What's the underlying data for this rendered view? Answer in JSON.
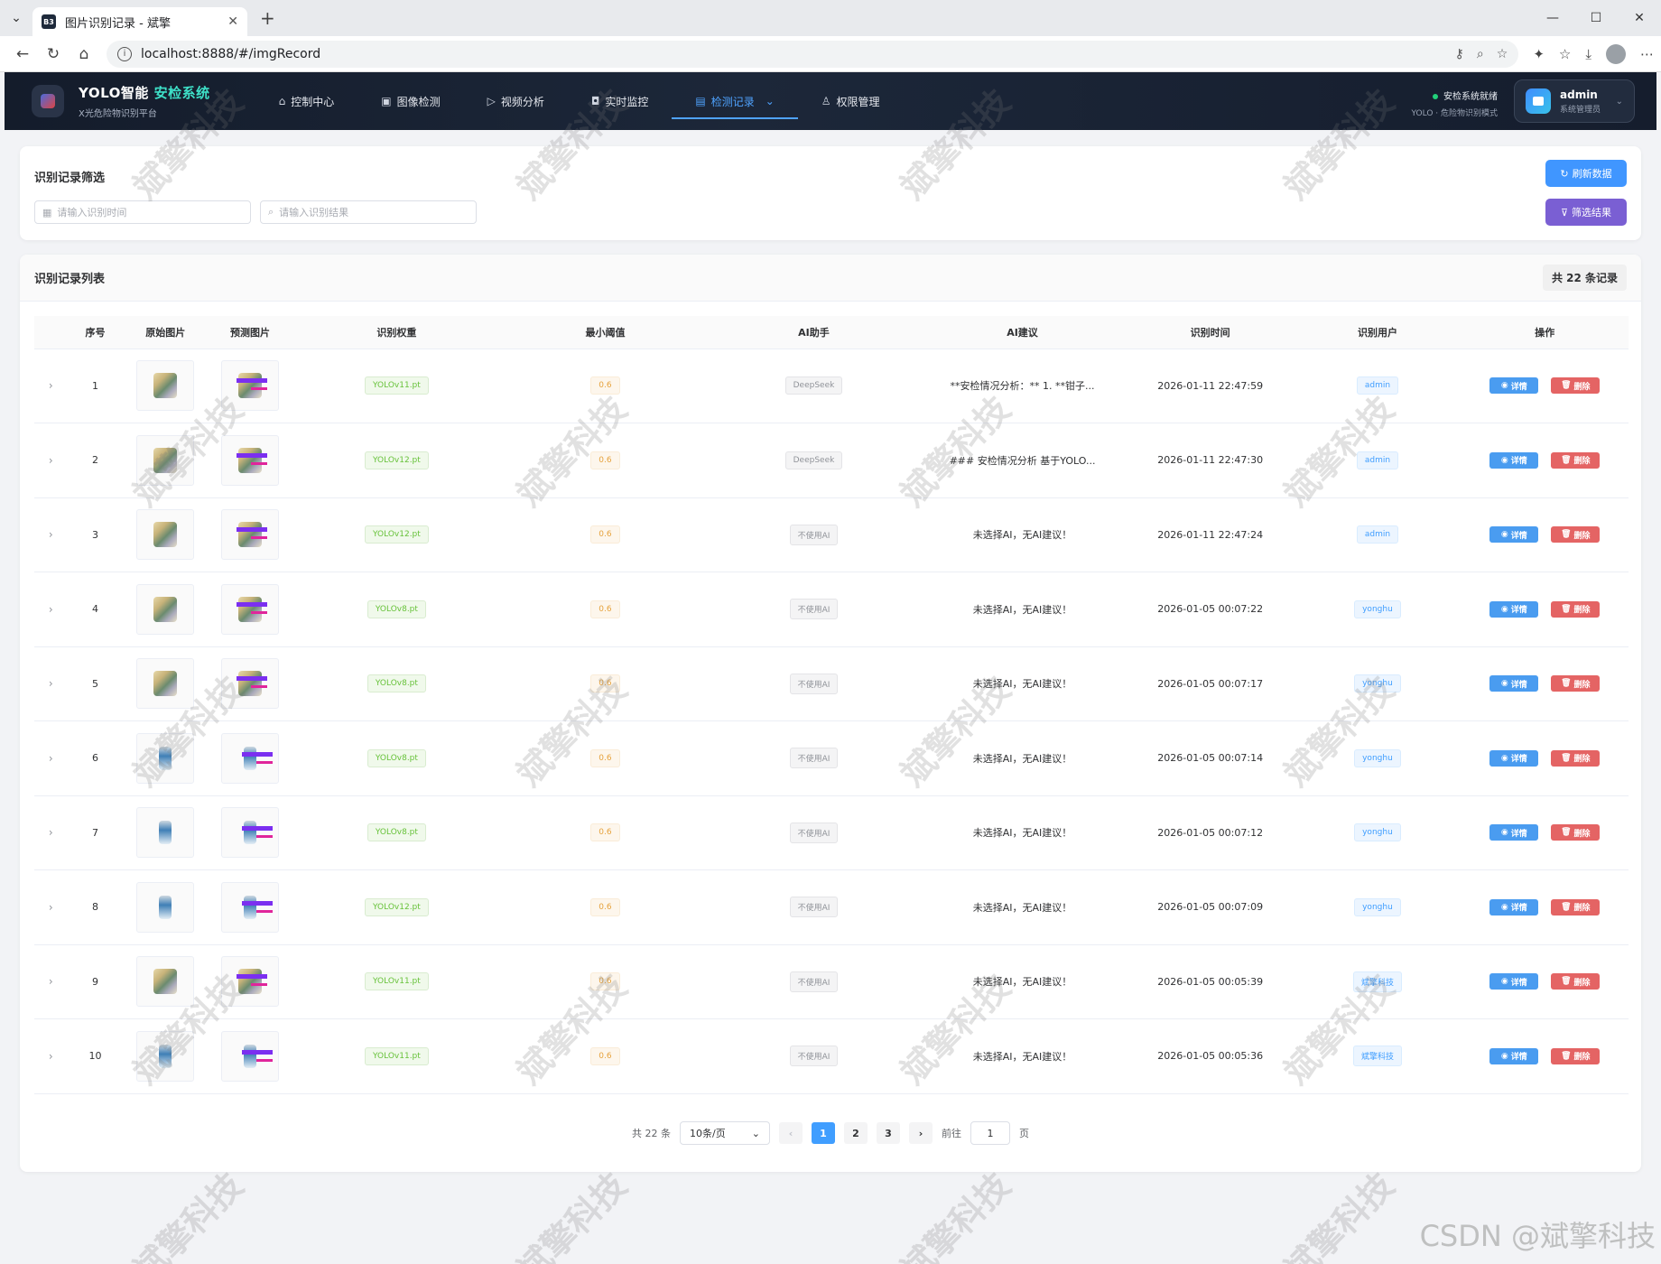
{
  "browser": {
    "tab_title": "图片识别记录 - 斌擎",
    "favicon": "B3",
    "url": "localhost:8888/#/imgRecord"
  },
  "header": {
    "brand_prefix": "YOLO智能 ",
    "brand_highlight": "安检系统",
    "subtitle": "X光危险物识别平台",
    "nav": [
      {
        "label": "控制中心",
        "icon": "home-icon"
      },
      {
        "label": "图像检测",
        "icon": "image-icon"
      },
      {
        "label": "视频分析",
        "icon": "play-icon"
      },
      {
        "label": "实时监控",
        "icon": "camera-icon"
      },
      {
        "label": "检测记录",
        "icon": "document-icon",
        "active": true
      },
      {
        "label": "权限管理",
        "icon": "user-icon"
      }
    ],
    "status_line1": "安检系统就绪",
    "status_line2": "YOLO · 危险物识别模式",
    "user_name": "admin",
    "user_role": "系统管理员"
  },
  "filter": {
    "title": "识别记录筛选",
    "time_placeholder": "请输入识别时间",
    "result_placeholder": "请输入识别结果",
    "refresh_label": "刷新数据",
    "filter_label": "筛选结果"
  },
  "list": {
    "title": "识别记录列表",
    "total": "共 22 条记录",
    "columns": [
      "序号",
      "原始图片",
      "预测图片",
      "识别权重",
      "最小阈值",
      "AI助手",
      "AI建议",
      "识别时间",
      "识别用户",
      "操作"
    ],
    "detail_label": "详情",
    "delete_label": "删除",
    "rows": [
      {
        "idx": "1",
        "weight": "YOLOv11.pt",
        "thr": "0.6",
        "ai": "DeepSeek",
        "sugg": "**安检情况分析：** 1. **钳子...",
        "time": "2026-01-11 22:47:59",
        "user": "admin"
      },
      {
        "idx": "2",
        "weight": "YOLOv12.pt",
        "thr": "0.6",
        "ai": "DeepSeek",
        "sugg": "### 安检情况分析 基于YOLO...",
        "time": "2026-01-11 22:47:30",
        "user": "admin"
      },
      {
        "idx": "3",
        "weight": "YOLOv12.pt",
        "thr": "0.6",
        "ai": "不使用AI",
        "sugg": "未选择AI，无AI建议！",
        "time": "2026-01-11 22:47:24",
        "user": "admin"
      },
      {
        "idx": "4",
        "weight": "YOLOv8.pt",
        "thr": "0.6",
        "ai": "不使用AI",
        "sugg": "未选择AI，无AI建议！",
        "time": "2026-01-05 00:07:22",
        "user": "yonghu"
      },
      {
        "idx": "5",
        "weight": "YOLOv8.pt",
        "thr": "0.6",
        "ai": "不使用AI",
        "sugg": "未选择AI，无AI建议！",
        "time": "2026-01-05 00:07:17",
        "user": "yonghu"
      },
      {
        "idx": "6",
        "weight": "YOLOv8.pt",
        "thr": "0.6",
        "ai": "不使用AI",
        "sugg": "未选择AI，无AI建议！",
        "time": "2026-01-05 00:07:14",
        "user": "yonghu"
      },
      {
        "idx": "7",
        "weight": "YOLOv8.pt",
        "thr": "0.6",
        "ai": "不使用AI",
        "sugg": "未选择AI，无AI建议！",
        "time": "2026-01-05 00:07:12",
        "user": "yonghu"
      },
      {
        "idx": "8",
        "weight": "YOLOv12.pt",
        "thr": "0.6",
        "ai": "不使用AI",
        "sugg": "未选择AI，无AI建议！",
        "time": "2026-01-05 00:07:09",
        "user": "yonghu"
      },
      {
        "idx": "9",
        "weight": "YOLOv11.pt",
        "thr": "0.6",
        "ai": "不使用AI",
        "sugg": "未选择AI，无AI建议！",
        "time": "2026-01-05 00:05:39",
        "user": "斌擎科技"
      },
      {
        "idx": "10",
        "weight": "YOLOv11.pt",
        "thr": "0.6",
        "ai": "不使用AI",
        "sugg": "未选择AI，无AI建议！",
        "time": "2026-01-05 00:05:36",
        "user": "斌擎科技"
      }
    ]
  },
  "pagination": {
    "total_text": "共 22 条",
    "page_size": "10条/页",
    "pages": [
      "1",
      "2",
      "3"
    ],
    "current": "1",
    "goto_label": "前往",
    "goto_value": "1",
    "page_suffix": "页"
  },
  "watermark": "斌擎科技",
  "csdn_mark": "CSDN @斌擎科技"
}
